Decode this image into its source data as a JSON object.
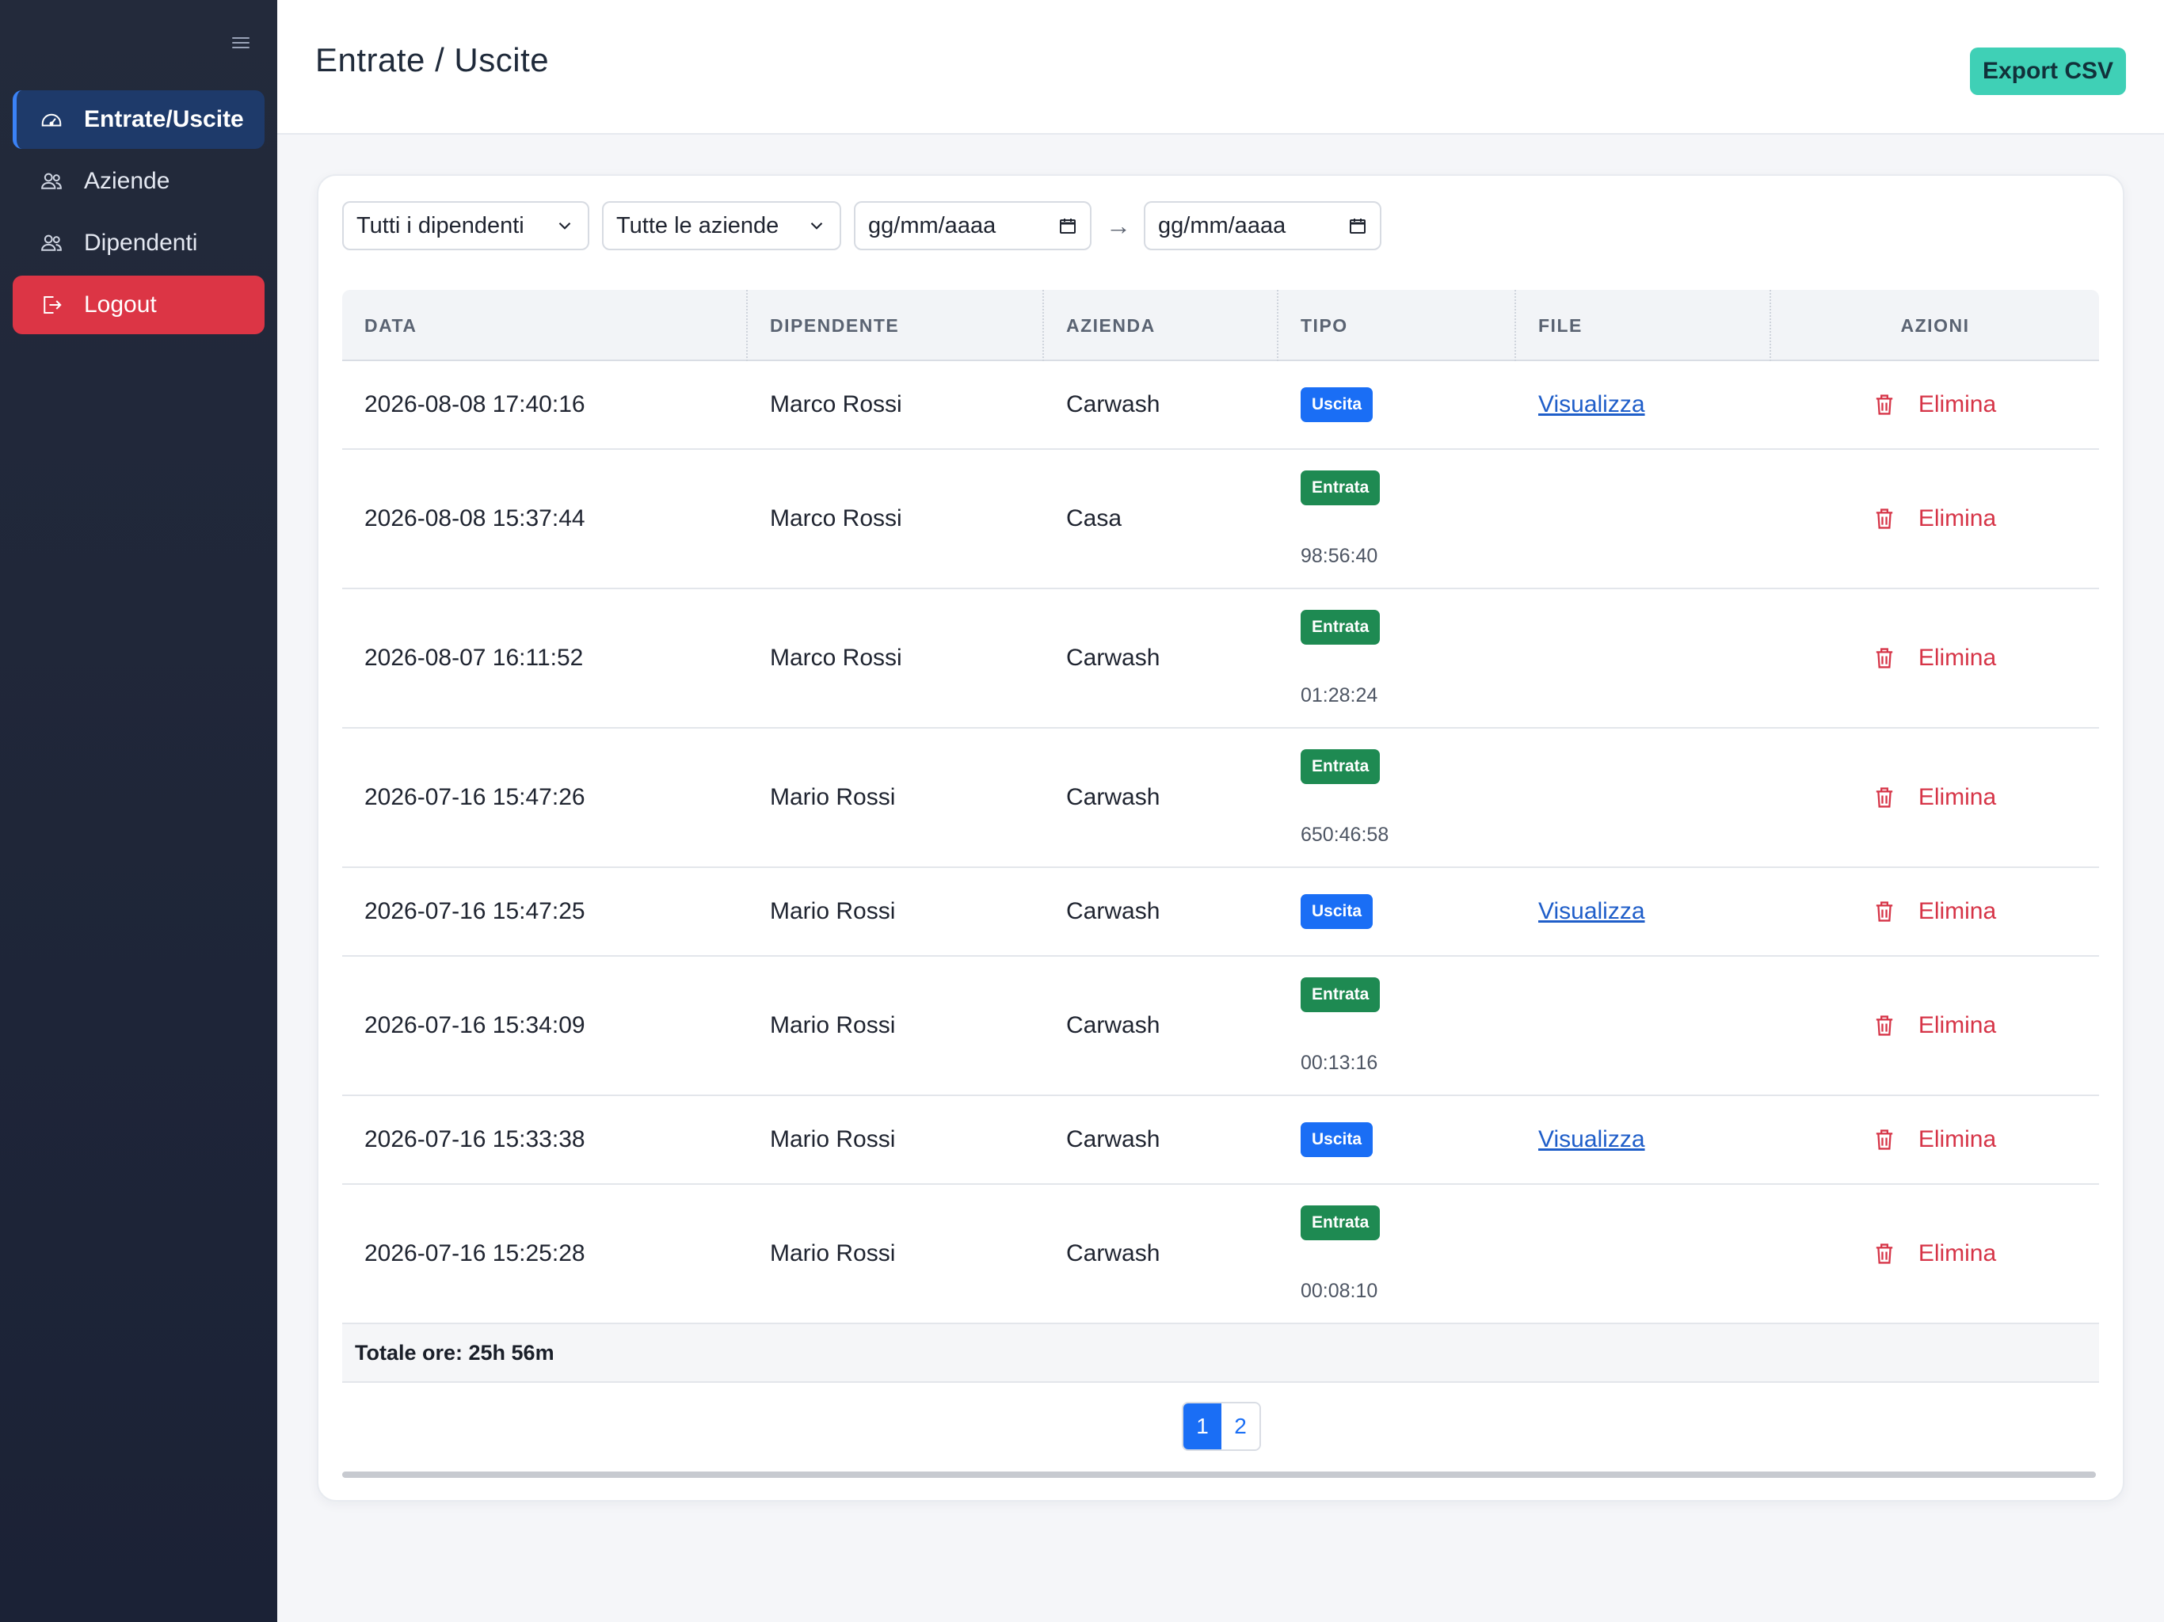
{
  "sidebar": {
    "items": [
      {
        "label": "Entrate/Uscite",
        "icon": "dashboard-icon"
      },
      {
        "label": "Aziende",
        "icon": "users-icon"
      },
      {
        "label": "Dipendenti",
        "icon": "users-icon"
      }
    ],
    "logout": {
      "label": "Logout",
      "icon": "logout-icon"
    }
  },
  "header": {
    "title": "Entrate / Uscite",
    "export_label": "Export CSV"
  },
  "filters": {
    "employee": "Tutti i dipendenti",
    "company": "Tutte le aziende",
    "date_from": "gg/mm/aaaa",
    "date_to": "gg/mm/aaaa",
    "separator": "→"
  },
  "table": {
    "headers": [
      "DATA",
      "DIPENDENTE",
      "AZIENDA",
      "TIPO",
      "FILE",
      "AZIONI"
    ],
    "rows": [
      {
        "data": "2026-08-08 17:40:16",
        "dipendente": "Marco Rossi",
        "azienda": "Carwash",
        "tipo": "Uscita",
        "durata": "",
        "file": "Visualizza",
        "azione": "Elimina"
      },
      {
        "data": "2026-08-08 15:37:44",
        "dipendente": "Marco Rossi",
        "azienda": "Casa",
        "tipo": "Entrata",
        "durata": "98:56:40",
        "file": "",
        "azione": "Elimina"
      },
      {
        "data": "2026-08-07 16:11:52",
        "dipendente": "Marco Rossi",
        "azienda": "Carwash",
        "tipo": "Entrata",
        "durata": "01:28:24",
        "file": "",
        "azione": "Elimina"
      },
      {
        "data": "2026-07-16 15:47:26",
        "dipendente": "Mario Rossi",
        "azienda": "Carwash",
        "tipo": "Entrata",
        "durata": "650:46:58",
        "file": "",
        "azione": "Elimina"
      },
      {
        "data": "2026-07-16 15:47:25",
        "dipendente": "Mario Rossi",
        "azienda": "Carwash",
        "tipo": "Uscita",
        "durata": "",
        "file": "Visualizza",
        "azione": "Elimina"
      },
      {
        "data": "2026-07-16 15:34:09",
        "dipendente": "Mario Rossi",
        "azienda": "Carwash",
        "tipo": "Entrata",
        "durata": "00:13:16",
        "file": "",
        "azione": "Elimina"
      },
      {
        "data": "2026-07-16 15:33:38",
        "dipendente": "Mario Rossi",
        "azienda": "Carwash",
        "tipo": "Uscita",
        "durata": "",
        "file": "Visualizza",
        "azione": "Elimina"
      },
      {
        "data": "2026-07-16 15:25:28",
        "dipendente": "Mario Rossi",
        "azienda": "Carwash",
        "tipo": "Entrata",
        "durata": "00:08:10",
        "file": "",
        "azione": "Elimina"
      }
    ],
    "total": "Totale ore: 25h 56m"
  },
  "pagination": {
    "pages": [
      "1",
      "2"
    ],
    "current": "1"
  },
  "colors": {
    "sidebar_bg": "#1f2638",
    "active_nav": "#1e3a6a",
    "logout": "#dc3545",
    "export": "#3fd0b6",
    "uscita": "#1a6ef5",
    "entrata": "#1e8a52",
    "danger_text": "#d63447"
  }
}
